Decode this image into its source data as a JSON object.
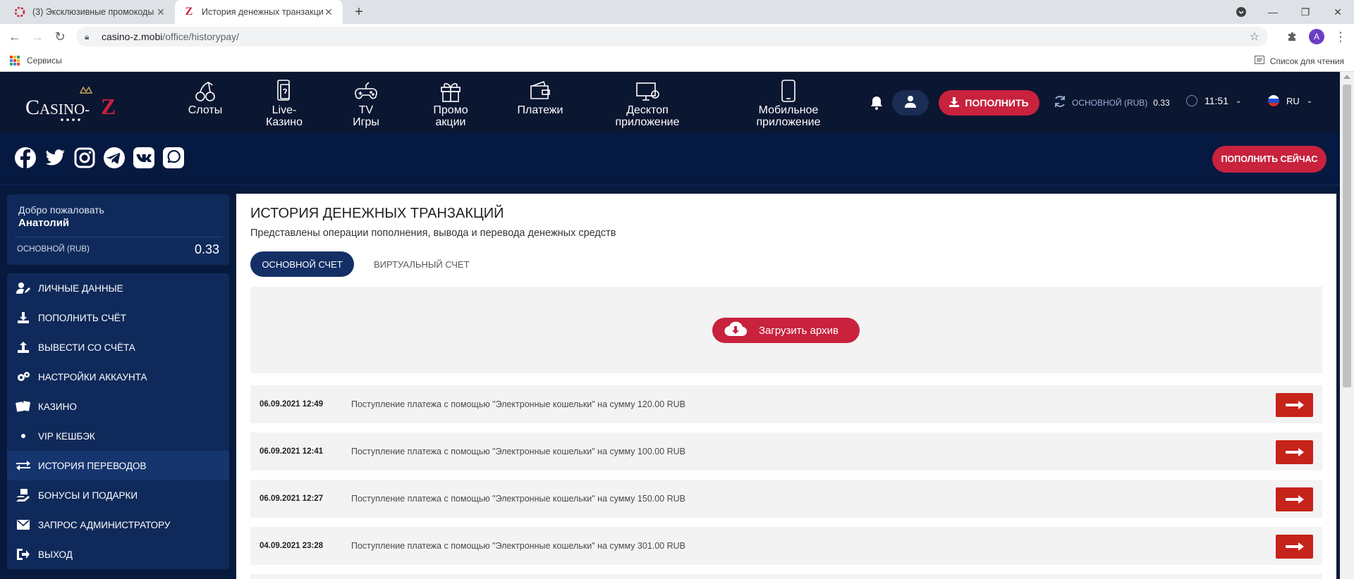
{
  "browser": {
    "tabs": [
      {
        "title": "(3) Эксклюзивные промокоды",
        "favicon": "casino-ring-icon"
      },
      {
        "title": "История денежных транзакций",
        "favicon": "z-letter-icon"
      }
    ],
    "url_host": "casino-z.mobi",
    "url_path": "/office/historypay/",
    "profile_initial": "A",
    "bookmarks": {
      "apps_label": "Сервисы",
      "reading_list_label": "Список для чтения"
    }
  },
  "header": {
    "logo_text": "CASINO-Z",
    "nav": [
      {
        "label_1": "Слоты",
        "label_2": "",
        "icon": "cherries-icon"
      },
      {
        "label_1": "Live-",
        "label_2": "Казино",
        "icon": "live-casino-icon"
      },
      {
        "label_1": "TV",
        "label_2": "Игры",
        "icon": "gamepad-icon"
      },
      {
        "label_1": "Промо",
        "label_2": "акции",
        "icon": "gift-icon"
      },
      {
        "label_1": "Платежи",
        "label_2": "",
        "icon": "wallet-icon"
      },
      {
        "label_1": "Десктоп",
        "label_2": "приложение",
        "icon": "desktop-icon"
      },
      {
        "label_1": "Мобильное",
        "label_2": "приложение",
        "icon": "mobile-icon"
      }
    ],
    "deposit_label": "ПОПОЛНИТЬ",
    "balance_label": "ОСНОВНОЙ (RUB)",
    "balance_value": "0.33",
    "time": "11:51",
    "language": "RU"
  },
  "social": {
    "icons": [
      "facebook-icon",
      "twitter-icon",
      "instagram-icon",
      "telegram-icon",
      "vk-icon",
      "chat-icon"
    ],
    "cta_label": "ПОПОЛНИТЬ СЕЙЧАС"
  },
  "sidebar": {
    "greeting": "Добро пожаловать",
    "username": "Анатолий",
    "balance_label": "ОСНОВНОЙ (RUB)",
    "balance_value": "0.33",
    "menu": [
      {
        "label": "ЛИЧНЫЕ ДАННЫЕ",
        "icon": "user-edit-icon"
      },
      {
        "label": "ПОПОЛНИТЬ СЧЁТ",
        "icon": "download-icon"
      },
      {
        "label": "ВЫВЕСТИ СО СЧЁТА",
        "icon": "upload-icon"
      },
      {
        "label": "НАСТРОЙКИ АККАУНТА",
        "icon": "gears-icon"
      },
      {
        "label": "КАЗИНО",
        "icon": "cards-icon"
      },
      {
        "label": "VIP КЕШБЭК",
        "icon": "dot-icon"
      },
      {
        "label": "ИСТОРИЯ ПЕРЕВОДОВ",
        "icon": "exchange-icon",
        "active": true
      },
      {
        "label": "БОНУСЫ И ПОДАРКИ",
        "icon": "hand-gift-icon"
      },
      {
        "label": "ЗАПРОС АДМИНИСТРАТОРУ",
        "icon": "envelope-icon"
      },
      {
        "label": "ВЫХОД",
        "icon": "sign-out-icon"
      }
    ]
  },
  "main": {
    "title": "ИСТОРИЯ ДЕНЕЖНЫХ ТРАНЗАКЦИЙ",
    "subtitle": "Представлены операции пополнения, вывода и перевода денежных средств",
    "tabs": [
      {
        "label": "ОСНОВНОЙ СЧЕТ",
        "active": true
      },
      {
        "label": "ВИРТУАЛЬНЫЙ СЧЕТ",
        "active": false
      }
    ],
    "archive_button": "Загрузить архив",
    "transactions": [
      {
        "date": "06.09.2021 12:49",
        "description": "Поступление платежа с помощью \"Электронные кошельки\" на сумму 120.00 RUB"
      },
      {
        "date": "06.09.2021 12:41",
        "description": "Поступление платежа с помощью \"Электронные кошельки\" на сумму 100.00 RUB"
      },
      {
        "date": "06.09.2021 12:27",
        "description": "Поступление платежа с помощью \"Электронные кошельки\" на сумму 150.00 RUB"
      },
      {
        "date": "04.09.2021 23:28",
        "description": "Поступление платежа с помощью \"Электронные кошельки\" на сумму 301.00 RUB"
      }
    ]
  },
  "colors": {
    "accent": "#c8223d",
    "navy": "#071a3d",
    "panel": "#0f2a5a",
    "arrow": "#c6231a"
  }
}
